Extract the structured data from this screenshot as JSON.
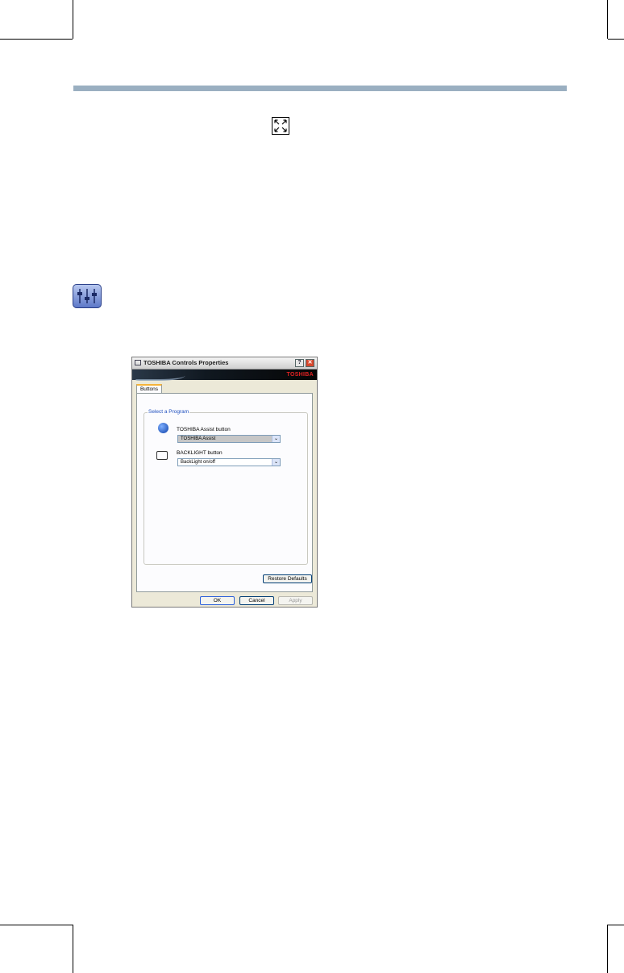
{
  "dialog": {
    "title": "TOSHIBA Controls Properties",
    "help_label": "?",
    "close_label": "✕",
    "brand": "TOSHIBA",
    "tab_label": "Buttons",
    "group_label": "Select a Program",
    "assist_label": "TOSHIBA Assist button",
    "assist_value": "TOSHIBA Assist",
    "backlight_label": "BACKLIGHT button",
    "backlight_value": "BackLight on/off",
    "dropdown_arrow": "⌄",
    "restore_label": "Restore Defaults",
    "ok_label": "OK",
    "cancel_label": "Cancel",
    "apply_label": "Apply"
  },
  "icons": {
    "fullscreen": "fullscreen-icon",
    "settings": "sliders-icon"
  },
  "colors": {
    "rule": "#9aafc1",
    "brand": "#e22222"
  }
}
